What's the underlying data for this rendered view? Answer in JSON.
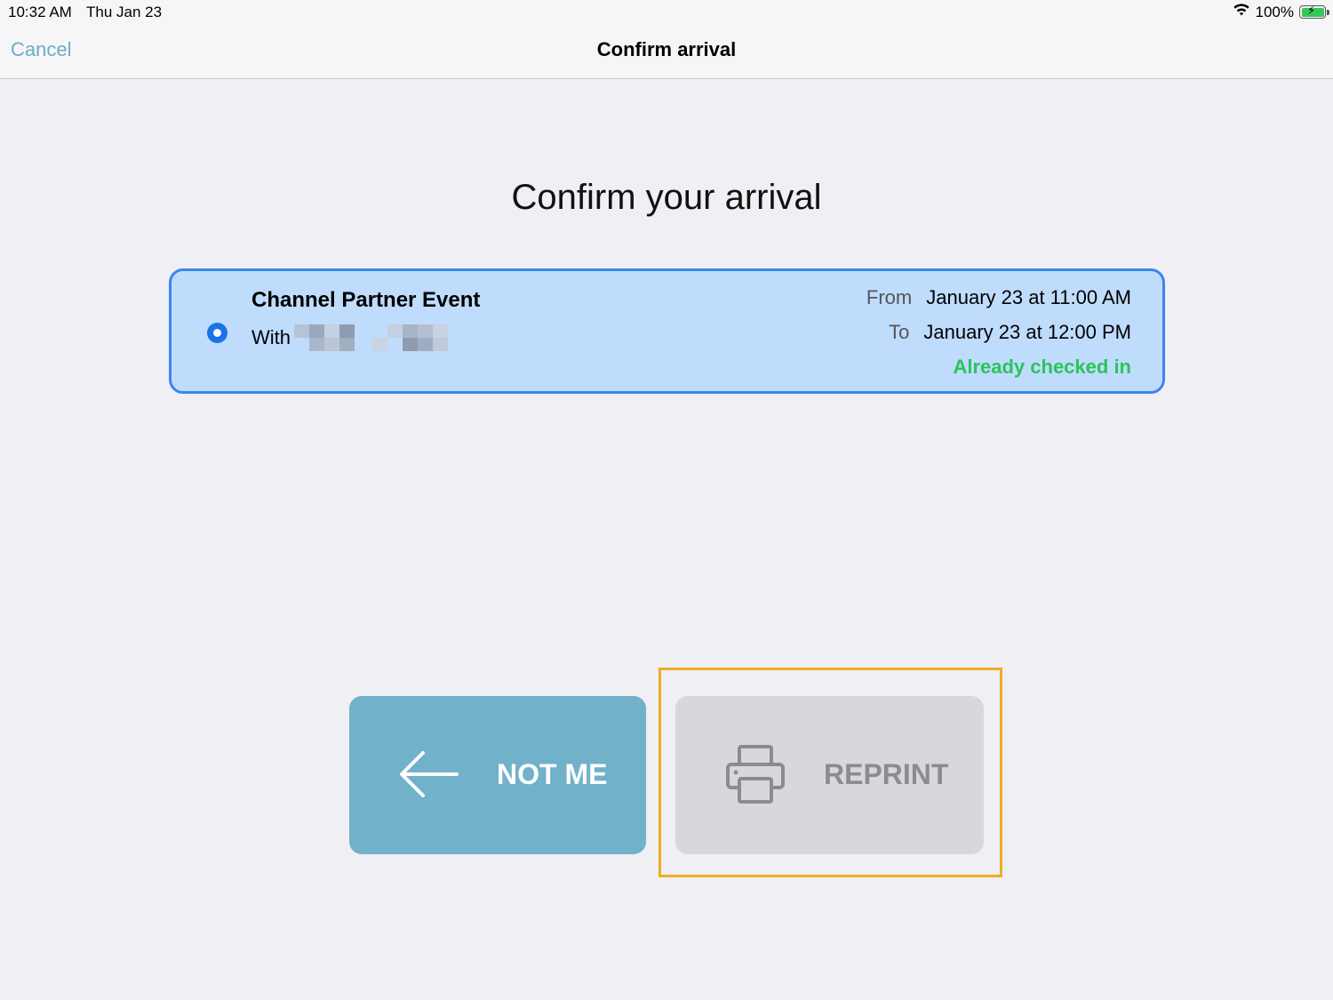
{
  "status_bar": {
    "time": "10:32 AM",
    "date": "Thu Jan 23",
    "battery": "100%",
    "icons": [
      "wifi-icon",
      "battery-charging-icon"
    ]
  },
  "nav": {
    "cancel_label": "Cancel",
    "title": "Confirm arrival"
  },
  "page": {
    "heading": "Confirm your arrival"
  },
  "event": {
    "title": "Channel Partner Event",
    "with_label": "With",
    "with_name": "",
    "from_label": "From",
    "from_value": "January 23 at 11:00 AM",
    "to_label": "To",
    "to_value": "January 23 at 12:00 PM",
    "status": "Already checked in",
    "selected": true
  },
  "actions": {
    "not_me_label": "NOT ME",
    "reprint_label": "REPRINT"
  },
  "colors": {
    "accent": "#6aaec5",
    "card_bg": "#bfdcfd",
    "card_border": "#3c86ec",
    "success": "#2ac45a",
    "highlight": "#f1ac20"
  }
}
